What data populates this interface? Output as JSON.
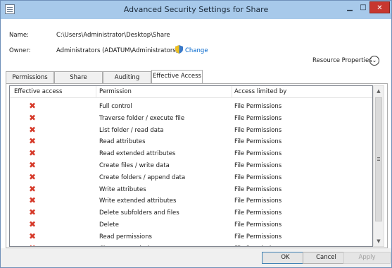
{
  "window": {
    "title": "Advanced Security Settings for Share",
    "controls": {
      "minimize": "▁",
      "maximize": "□",
      "close": "✕"
    }
  },
  "info": {
    "name_label": "Name:",
    "name_value": "C:\\Users\\Administrator\\Desktop\\Share",
    "owner_label": "Owner:",
    "owner_value": "Administrators (ADATUM\\Administrators)",
    "change_link": "Change",
    "resource_properties": "Resource Properties",
    "resource_properties_icon": "chevron-down-icon"
  },
  "tabs": [
    {
      "label": "Permissions"
    },
    {
      "label": "Share"
    },
    {
      "label": "Auditing"
    },
    {
      "label": "Effective Access"
    }
  ],
  "active_tab": "Effective Access",
  "table": {
    "headers": [
      "Effective access",
      "Permission",
      "Access limited by"
    ],
    "rows": [
      {
        "effective_access": "denied",
        "permission": "Full control",
        "limited_by": "File Permissions"
      },
      {
        "effective_access": "denied",
        "permission": "Traverse folder / execute file",
        "limited_by": "File Permissions"
      },
      {
        "effective_access": "denied",
        "permission": "List folder / read data",
        "limited_by": "File Permissions"
      },
      {
        "effective_access": "denied",
        "permission": "Read attributes",
        "limited_by": "File Permissions"
      },
      {
        "effective_access": "denied",
        "permission": "Read extended attributes",
        "limited_by": "File Permissions"
      },
      {
        "effective_access": "denied",
        "permission": "Create files / write data",
        "limited_by": "File Permissions"
      },
      {
        "effective_access": "denied",
        "permission": "Create folders / append data",
        "limited_by": "File Permissions"
      },
      {
        "effective_access": "denied",
        "permission": "Write attributes",
        "limited_by": "File Permissions"
      },
      {
        "effective_access": "denied",
        "permission": "Write extended attributes",
        "limited_by": "File Permissions"
      },
      {
        "effective_access": "denied",
        "permission": "Delete subfolders and files",
        "limited_by": "File Permissions"
      },
      {
        "effective_access": "denied",
        "permission": "Delete",
        "limited_by": "File Permissions"
      },
      {
        "effective_access": "denied",
        "permission": "Read permissions",
        "limited_by": "File Permissions"
      },
      {
        "effective_access": "denied",
        "permission": "Change permissions",
        "limited_by": "File Permissions"
      }
    ]
  },
  "footer": {
    "ok": "OK",
    "cancel": "Cancel",
    "apply": "Apply"
  },
  "colors": {
    "titlebar": "#a7c9ea",
    "deny_icon": "#d63a2a",
    "close_button": "#c7372f",
    "link": "#0066cc"
  }
}
